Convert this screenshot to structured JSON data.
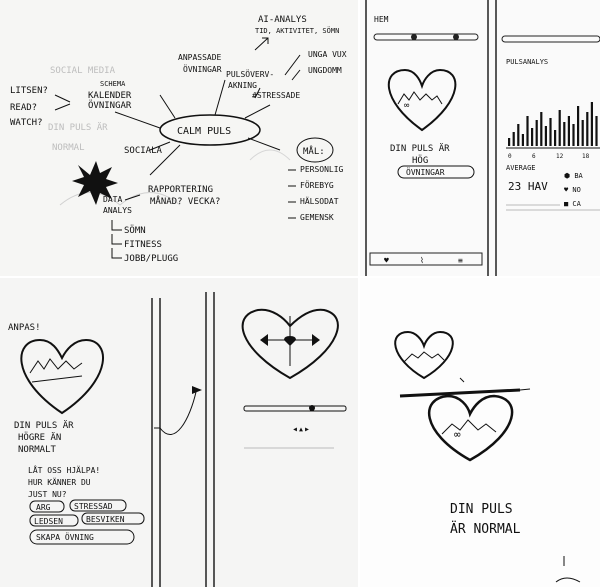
{
  "panel1": {
    "center": "CALM PULS",
    "left_words": [
      "LITSEN?",
      "READ?",
      "WATCH?"
    ],
    "schema": "SCHEMA",
    "kalender": [
      "KALENDER",
      "ÖVNINGAR"
    ],
    "anpassade": [
      "ANPASSADE",
      "ÖVNINGAR"
    ],
    "pulsover": [
      "PULSÖVERV-",
      "AKNING"
    ],
    "ai": [
      "AI-ANALYS",
      "TID, AKTIVITET, SÖMN"
    ],
    "unga": [
      "UNGA VUX",
      "UNGDOMM"
    ],
    "stressade": "#STRESSADE",
    "sociala": "SOCIALA",
    "rapportering": [
      "RAPPORTERING",
      "MÅNAD? VECKA?"
    ],
    "data": [
      "DATA",
      "ANALYS"
    ],
    "sub_items": [
      "SÖMN",
      "FITNESS",
      "JOBB/PLUGG"
    ],
    "mal_title": "MÅL:",
    "mal_items": [
      "PERSONLIG",
      "FÖREBYG",
      "HÄLSODAT",
      "GEMENSK"
    ]
  },
  "panel2": {
    "hem": "HEM",
    "status": [
      "DIN PULS ÄR",
      "HÖG"
    ],
    "button": "ÖVNINGAR",
    "analys": "PULSANALYS",
    "ticks": [
      "0",
      "6",
      "12",
      "18"
    ],
    "average": "AVERAGE",
    "value": "23 HAV",
    "bars": [
      8,
      14,
      22,
      12,
      30,
      18,
      26,
      34,
      20,
      28,
      16,
      36,
      24,
      30,
      22,
      40,
      26,
      34,
      44,
      30
    ]
  },
  "panel3": {
    "anpas": "ANPAS!",
    "status": [
      "DIN PULS ÄR",
      "HÖGRE ÄN",
      "NORMALT"
    ],
    "help": [
      "LÅT OSS HJÄLPA!",
      "HUR KÄNNER DU",
      "JUST NU?"
    ],
    "chips": [
      "ARG",
      "STRESSAD",
      "LEDSEN",
      "BESVIKEN"
    ],
    "create": "SKAPA ÖVNING"
  },
  "panel4": {
    "status": [
      "DIN PULS",
      "ÄR NORMAL"
    ]
  }
}
